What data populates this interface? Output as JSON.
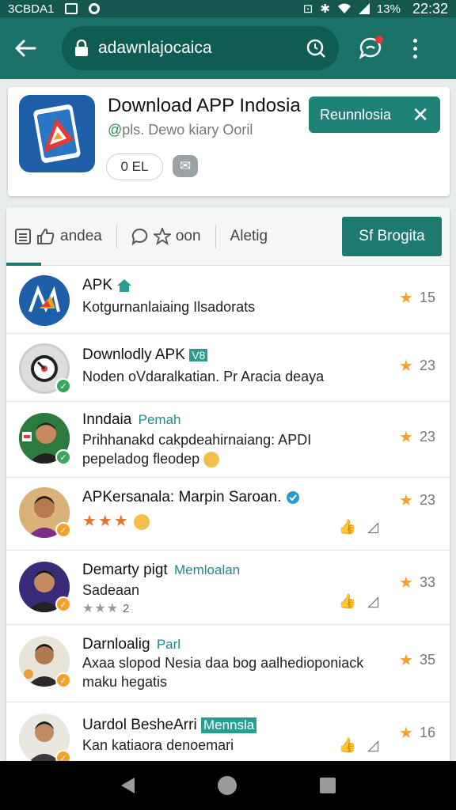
{
  "status_bar": {
    "carrier": "3CBDA1",
    "battery": "13%",
    "time": "22:32"
  },
  "app_bar": {
    "url": "adawnlajocaica"
  },
  "header": {
    "title": "Download APP Indosia",
    "subtitle_prefix": "@",
    "subtitle": "pls. Dewo kiary Ooril",
    "version_pill": "0 EL",
    "action_button": "Reunnlosia",
    "action_close": "✕"
  },
  "tabs": {
    "tab1": "andea",
    "tab2": "oon",
    "tab3": "Aletig",
    "active_tab": "Sf Brogita"
  },
  "items": [
    {
      "title": "APK",
      "desc": "Kotgurnanlaiaing Ilsadorats",
      "rating": "15"
    },
    {
      "title": "Downlodly APK",
      "tag": "V8",
      "desc": "Noden oVdaralkatian. Pr Aracia deaya",
      "rating": "23"
    },
    {
      "title": "Inndaia",
      "tag": "Pemah",
      "desc1": "Prihhanakd cakpdeahirnaiang: APDI",
      "desc2": "pepeladog fleodep",
      "rating": "23"
    },
    {
      "title": "APKersanala: Marpin Saroan.",
      "rating": "23"
    },
    {
      "title": "Demarty pigt",
      "tag": "Memloalan",
      "desc1": "Sadeaan",
      "desc2": "2",
      "rating": "33"
    },
    {
      "title": "Darnloalig",
      "tag": "Parl",
      "desc1": "Axaa slopod Nesia daa bog aalhedioponiack",
      "desc2": "maku hegatis",
      "rating": "35"
    },
    {
      "title": "Uardol BesheArri",
      "tag": "Mennsla",
      "desc1": "Kan katiaora denoemari",
      "rating": "16"
    }
  ],
  "colors": {
    "primary": "#1a7268",
    "accent": "#1e8277",
    "star": "#f4a12a"
  }
}
